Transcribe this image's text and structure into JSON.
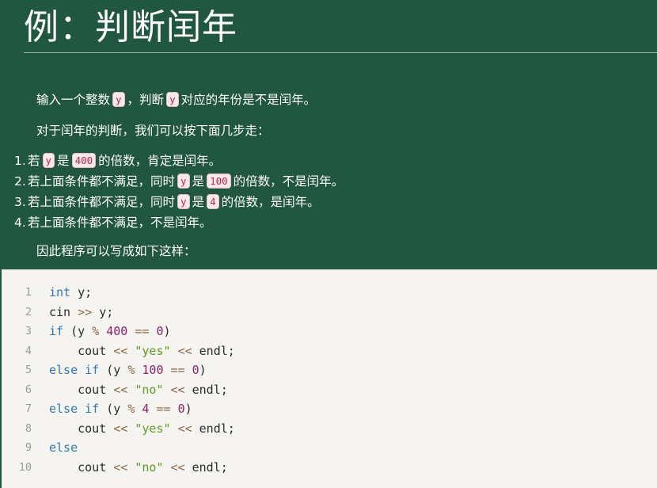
{
  "title": "例：判断闰年",
  "intro": {
    "p1": [
      "输入一个整数",
      "y",
      "，判断",
      "y",
      "对应的年份是不是闰年。"
    ],
    "p2": "对于闰年的判断，我们可以按下面几步走：",
    "p3": "因此程序可以写成如下这样："
  },
  "steps": [
    {
      "num": "1.",
      "parts": [
        "若",
        "y",
        "是",
        "400",
        "的倍数，肯定是闰年。"
      ]
    },
    {
      "num": "2.",
      "parts": [
        "若上面条件都不满足，同时",
        "y",
        "是",
        "100",
        "的倍数，不是闰年。"
      ]
    },
    {
      "num": "3.",
      "parts": [
        "若上面条件都不满足，同时",
        "y",
        "是",
        "4",
        "的倍数，是闰年。"
      ]
    },
    {
      "num": "4.",
      "parts": [
        "若上面条件都不满足，不是闰年。"
      ]
    }
  ],
  "code": {
    "line_numbers": [
      "1",
      "2",
      "3",
      "4",
      "5",
      "6",
      "7",
      "8",
      "9",
      "10"
    ],
    "lines": [
      [
        {
          "t": "int",
          "c": "kw"
        },
        {
          "t": " y;",
          "c": ""
        }
      ],
      [
        {
          "t": "cin ",
          "c": ""
        },
        {
          "t": ">>",
          "c": "op"
        },
        {
          "t": " y;",
          "c": ""
        }
      ],
      [
        {
          "t": "if",
          "c": "kw"
        },
        {
          "t": " (y ",
          "c": ""
        },
        {
          "t": "%",
          "c": "op"
        },
        {
          "t": " ",
          "c": ""
        },
        {
          "t": "400",
          "c": "num-lit"
        },
        {
          "t": " ",
          "c": ""
        },
        {
          "t": "==",
          "c": "op"
        },
        {
          "t": " ",
          "c": ""
        },
        {
          "t": "0",
          "c": "num-lit"
        },
        {
          "t": ")",
          "c": ""
        }
      ],
      [
        {
          "t": "    cout ",
          "c": ""
        },
        {
          "t": "<<",
          "c": "op"
        },
        {
          "t": " ",
          "c": ""
        },
        {
          "t": "\"yes\"",
          "c": "str"
        },
        {
          "t": " ",
          "c": ""
        },
        {
          "t": "<<",
          "c": "op"
        },
        {
          "t": " endl;",
          "c": ""
        }
      ],
      [
        {
          "t": "else if",
          "c": "kw"
        },
        {
          "t": " (y ",
          "c": ""
        },
        {
          "t": "%",
          "c": "op"
        },
        {
          "t": " ",
          "c": ""
        },
        {
          "t": "100",
          "c": "num-lit"
        },
        {
          "t": " ",
          "c": ""
        },
        {
          "t": "==",
          "c": "op"
        },
        {
          "t": " ",
          "c": ""
        },
        {
          "t": "0",
          "c": "num-lit"
        },
        {
          "t": ")",
          "c": ""
        }
      ],
      [
        {
          "t": "    cout ",
          "c": ""
        },
        {
          "t": "<<",
          "c": "op"
        },
        {
          "t": " ",
          "c": ""
        },
        {
          "t": "\"no\"",
          "c": "str"
        },
        {
          "t": " ",
          "c": ""
        },
        {
          "t": "<<",
          "c": "op"
        },
        {
          "t": " endl;",
          "c": ""
        }
      ],
      [
        {
          "t": "else if",
          "c": "kw"
        },
        {
          "t": " (y ",
          "c": ""
        },
        {
          "t": "%",
          "c": "op"
        },
        {
          "t": " ",
          "c": ""
        },
        {
          "t": "4",
          "c": "num-lit"
        },
        {
          "t": " ",
          "c": ""
        },
        {
          "t": "==",
          "c": "op"
        },
        {
          "t": " ",
          "c": ""
        },
        {
          "t": "0",
          "c": "num-lit"
        },
        {
          "t": ")",
          "c": ""
        }
      ],
      [
        {
          "t": "    cout ",
          "c": ""
        },
        {
          "t": "<<",
          "c": "op"
        },
        {
          "t": " ",
          "c": ""
        },
        {
          "t": "\"yes\"",
          "c": "str"
        },
        {
          "t": " ",
          "c": ""
        },
        {
          "t": "<<",
          "c": "op"
        },
        {
          "t": " endl;",
          "c": ""
        }
      ],
      [
        {
          "t": "else",
          "c": "kw"
        }
      ],
      [
        {
          "t": "    cout ",
          "c": ""
        },
        {
          "t": "<<",
          "c": "op"
        },
        {
          "t": " ",
          "c": ""
        },
        {
          "t": "\"no\"",
          "c": "str"
        },
        {
          "t": " ",
          "c": ""
        },
        {
          "t": "<<",
          "c": "op"
        },
        {
          "t": " endl;",
          "c": ""
        }
      ]
    ]
  },
  "colors": {
    "background": "#215640",
    "code_background": "#f6f4f1",
    "inline_code": "#c7254e",
    "keyword": "#2f78b4",
    "number": "#8f1f69",
    "string": "#5e9c22"
  }
}
